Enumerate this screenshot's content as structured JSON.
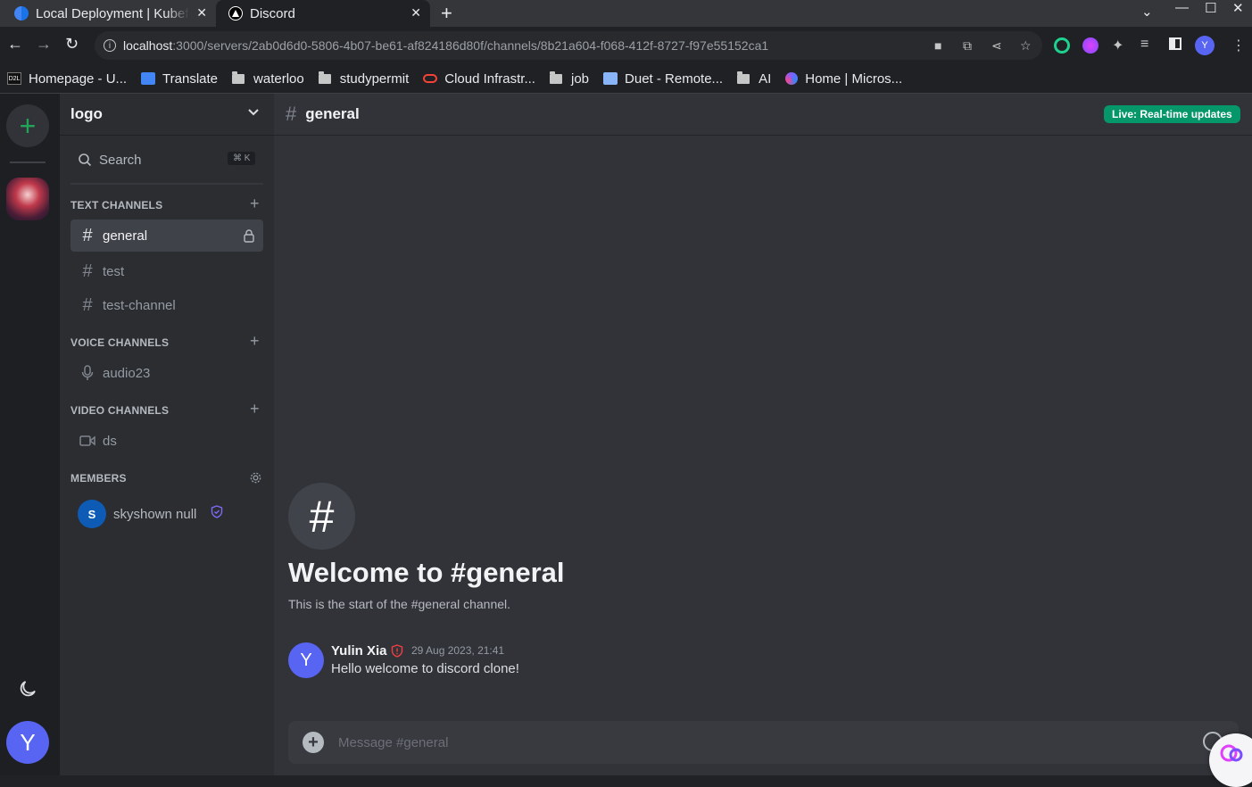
{
  "browser": {
    "tabs": [
      {
        "title": "Local Deployment | Kubef",
        "active": false
      },
      {
        "title": "Discord",
        "active": true
      }
    ],
    "url": {
      "host": "localhost",
      "rest": ":3000/servers/2ab0d6d0-5806-4b07-be61-af824186d80f/channels/8b21a604-f068-412f-8727-f97e55152ca1"
    },
    "profile_initial": "Y",
    "bookmarks": [
      {
        "label": "Homepage - U...",
        "icon": "d2l-logo"
      },
      {
        "label": "Translate",
        "icon": "google-translate-icon"
      },
      {
        "label": "waterloo",
        "icon": "folder-icon"
      },
      {
        "label": "studypermit",
        "icon": "folder-icon"
      },
      {
        "label": "Cloud Infrastr...",
        "icon": "oracle-icon"
      },
      {
        "label": "job",
        "icon": "folder-icon"
      },
      {
        "label": "Duet - Remote...",
        "icon": "duet-icon"
      },
      {
        "label": "AI",
        "icon": "folder-icon"
      },
      {
        "label": "Home | Micros...",
        "icon": "microsoft-icon"
      }
    ]
  },
  "server": {
    "name": "logo",
    "search_label": "Search",
    "search_shortcut": "⌘ K",
    "sections": {
      "text": "TEXT CHANNELS",
      "voice": "VOICE CHANNELS",
      "video": "VIDEO CHANNELS",
      "members": "MEMBERS"
    },
    "text_channels": [
      "general",
      "test",
      "test-channel"
    ],
    "voice_channels": [
      "audio23"
    ],
    "video_channels": [
      "ds"
    ],
    "members": [
      {
        "initial": "S",
        "name": "skyshown null"
      }
    ]
  },
  "chat": {
    "channel": "general",
    "live_badge": "Live: Real-time updates",
    "welcome_title": "Welcome to #general",
    "welcome_subtitle": "This is the start of the #general channel.",
    "messages": [
      {
        "initial": "Y",
        "author": "Yulin Xia",
        "time": "29 Aug 2023, 21:41",
        "text": "Hello welcome to discord clone!"
      }
    ],
    "composer_placeholder": "Message #general"
  },
  "user": {
    "initial": "Y"
  },
  "colors": {
    "accent": "#5865f2",
    "live_badge": "#059669",
    "add_server_green": "#23a559",
    "background": "#313338",
    "sidebar": "#2b2d31",
    "rail": "#1e1f22"
  }
}
